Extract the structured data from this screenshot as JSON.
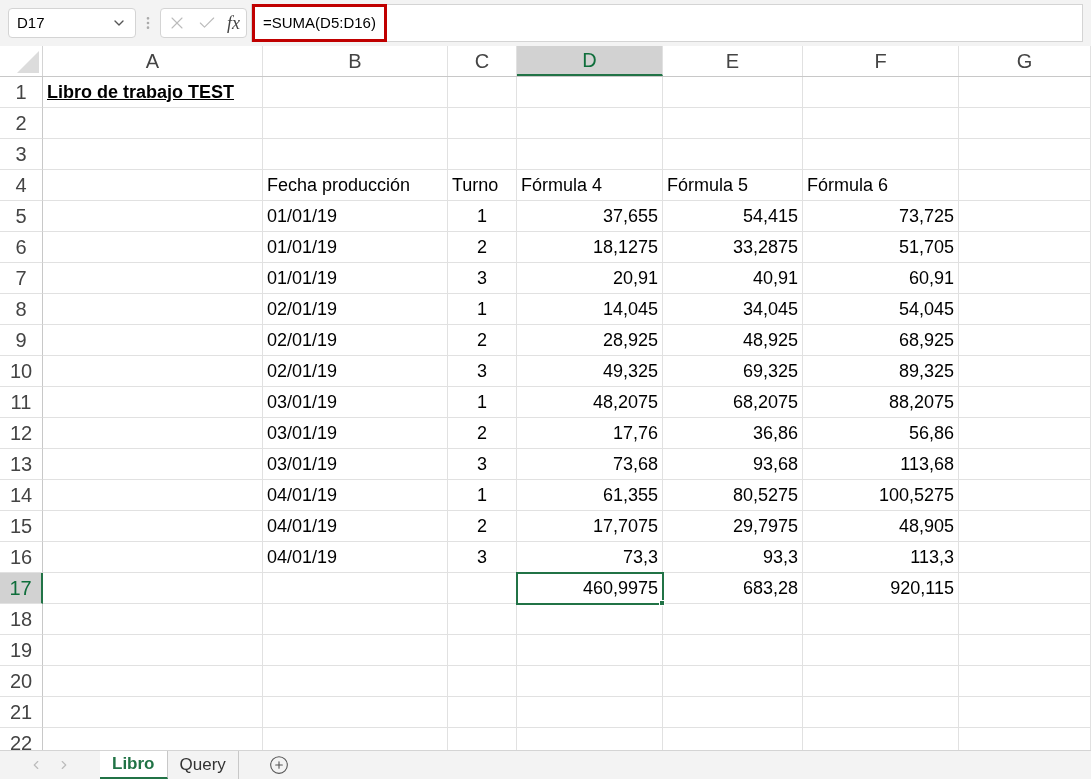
{
  "formula_bar": {
    "name_box": "D17",
    "function_label": "fx",
    "formula": "=SUMA(D5:D16)",
    "highlighted": true
  },
  "columns": [
    {
      "label": "A",
      "selected": false
    },
    {
      "label": "B",
      "selected": false
    },
    {
      "label": "C",
      "selected": false
    },
    {
      "label": "D",
      "selected": true
    },
    {
      "label": "E",
      "selected": false
    },
    {
      "label": "F",
      "selected": false
    },
    {
      "label": "G",
      "selected": false
    }
  ],
  "rows": [
    {
      "label": "1",
      "selected": false,
      "cells": [
        {
          "text": "Libro de trabajo TEST",
          "kind": "title"
        },
        null,
        null,
        null,
        null,
        null,
        null
      ]
    },
    {
      "label": "2",
      "selected": false,
      "cells": [
        null,
        null,
        null,
        null,
        null,
        null,
        null
      ]
    },
    {
      "label": "3",
      "selected": false,
      "cells": [
        null,
        null,
        null,
        null,
        null,
        null,
        null
      ]
    },
    {
      "label": "4",
      "selected": false,
      "cells": [
        null,
        {
          "text": "Fecha producción",
          "kind": "text"
        },
        {
          "text": "Turno",
          "kind": "text"
        },
        {
          "text": "Fórmula 4",
          "kind": "text"
        },
        {
          "text": "Fórmula 5",
          "kind": "text"
        },
        {
          "text": "Fórmula 6",
          "kind": "text"
        },
        null
      ]
    },
    {
      "label": "5",
      "selected": false,
      "cells": [
        null,
        {
          "text": "01/01/19",
          "kind": "text"
        },
        {
          "text": "1",
          "kind": "centered"
        },
        {
          "text": "37,655",
          "kind": "number"
        },
        {
          "text": "54,415",
          "kind": "number"
        },
        {
          "text": "73,725",
          "kind": "number"
        },
        null
      ]
    },
    {
      "label": "6",
      "selected": false,
      "cells": [
        null,
        {
          "text": "01/01/19",
          "kind": "text"
        },
        {
          "text": "2",
          "kind": "centered"
        },
        {
          "text": "18,1275",
          "kind": "number"
        },
        {
          "text": "33,2875",
          "kind": "number"
        },
        {
          "text": "51,705",
          "kind": "number"
        },
        null
      ]
    },
    {
      "label": "7",
      "selected": false,
      "cells": [
        null,
        {
          "text": "01/01/19",
          "kind": "text"
        },
        {
          "text": "3",
          "kind": "centered"
        },
        {
          "text": "20,91",
          "kind": "number"
        },
        {
          "text": "40,91",
          "kind": "number"
        },
        {
          "text": "60,91",
          "kind": "number"
        },
        null
      ]
    },
    {
      "label": "8",
      "selected": false,
      "cells": [
        null,
        {
          "text": "02/01/19",
          "kind": "text"
        },
        {
          "text": "1",
          "kind": "centered"
        },
        {
          "text": "14,045",
          "kind": "number"
        },
        {
          "text": "34,045",
          "kind": "number"
        },
        {
          "text": "54,045",
          "kind": "number"
        },
        null
      ]
    },
    {
      "label": "9",
      "selected": false,
      "cells": [
        null,
        {
          "text": "02/01/19",
          "kind": "text"
        },
        {
          "text": "2",
          "kind": "centered"
        },
        {
          "text": "28,925",
          "kind": "number"
        },
        {
          "text": "48,925",
          "kind": "number"
        },
        {
          "text": "68,925",
          "kind": "number"
        },
        null
      ]
    },
    {
      "label": "10",
      "selected": false,
      "cells": [
        null,
        {
          "text": "02/01/19",
          "kind": "text"
        },
        {
          "text": "3",
          "kind": "centered"
        },
        {
          "text": "49,325",
          "kind": "number"
        },
        {
          "text": "69,325",
          "kind": "number"
        },
        {
          "text": "89,325",
          "kind": "number"
        },
        null
      ]
    },
    {
      "label": "11",
      "selected": false,
      "cells": [
        null,
        {
          "text": "03/01/19",
          "kind": "text"
        },
        {
          "text": "1",
          "kind": "centered"
        },
        {
          "text": "48,2075",
          "kind": "number"
        },
        {
          "text": "68,2075",
          "kind": "number"
        },
        {
          "text": "88,2075",
          "kind": "number"
        },
        null
      ]
    },
    {
      "label": "12",
      "selected": false,
      "cells": [
        null,
        {
          "text": "03/01/19",
          "kind": "text"
        },
        {
          "text": "2",
          "kind": "centered"
        },
        {
          "text": "17,76",
          "kind": "number"
        },
        {
          "text": "36,86",
          "kind": "number"
        },
        {
          "text": "56,86",
          "kind": "number"
        },
        null
      ]
    },
    {
      "label": "13",
      "selected": false,
      "cells": [
        null,
        {
          "text": "03/01/19",
          "kind": "text"
        },
        {
          "text": "3",
          "kind": "centered"
        },
        {
          "text": "73,68",
          "kind": "number"
        },
        {
          "text": "93,68",
          "kind": "number"
        },
        {
          "text": "113,68",
          "kind": "number"
        },
        null
      ]
    },
    {
      "label": "14",
      "selected": false,
      "cells": [
        null,
        {
          "text": "04/01/19",
          "kind": "text"
        },
        {
          "text": "1",
          "kind": "centered"
        },
        {
          "text": "61,355",
          "kind": "number"
        },
        {
          "text": "80,5275",
          "kind": "number"
        },
        {
          "text": "100,5275",
          "kind": "number"
        },
        null
      ]
    },
    {
      "label": "15",
      "selected": false,
      "cells": [
        null,
        {
          "text": "04/01/19",
          "kind": "text"
        },
        {
          "text": "2",
          "kind": "centered"
        },
        {
          "text": "17,7075",
          "kind": "number"
        },
        {
          "text": "29,7975",
          "kind": "number"
        },
        {
          "text": "48,905",
          "kind": "number"
        },
        null
      ]
    },
    {
      "label": "16",
      "selected": false,
      "cells": [
        null,
        {
          "text": "04/01/19",
          "kind": "text"
        },
        {
          "text": "3",
          "kind": "centered"
        },
        {
          "text": "73,3",
          "kind": "number"
        },
        {
          "text": "93,3",
          "kind": "number"
        },
        {
          "text": "113,3",
          "kind": "number"
        },
        null
      ]
    },
    {
      "label": "17",
      "selected": true,
      "cells": [
        null,
        null,
        null,
        {
          "text": "460,9975",
          "kind": "number",
          "selected": true
        },
        {
          "text": "683,28",
          "kind": "number",
          "selected": false
        },
        {
          "text": "920,115",
          "kind": "number",
          "selected": false
        },
        null
      ]
    },
    {
      "label": "18",
      "selected": false,
      "cells": [
        null,
        null,
        null,
        null,
        null,
        null,
        null
      ]
    },
    {
      "label": "19",
      "selected": false,
      "cells": [
        null,
        null,
        null,
        null,
        null,
        null,
        null
      ]
    },
    {
      "label": "20",
      "selected": false,
      "cells": [
        null,
        null,
        null,
        null,
        null,
        null,
        null
      ]
    },
    {
      "label": "21",
      "selected": false,
      "cells": [
        null,
        null,
        null,
        null,
        null,
        null,
        null
      ]
    },
    {
      "label": "22",
      "selected": false,
      "cells": [
        null,
        null,
        null,
        null,
        null,
        null,
        null
      ]
    }
  ],
  "sheet_tabs": [
    {
      "label": "Libro",
      "selected": true
    },
    {
      "label": "Query",
      "selected": false
    }
  ]
}
